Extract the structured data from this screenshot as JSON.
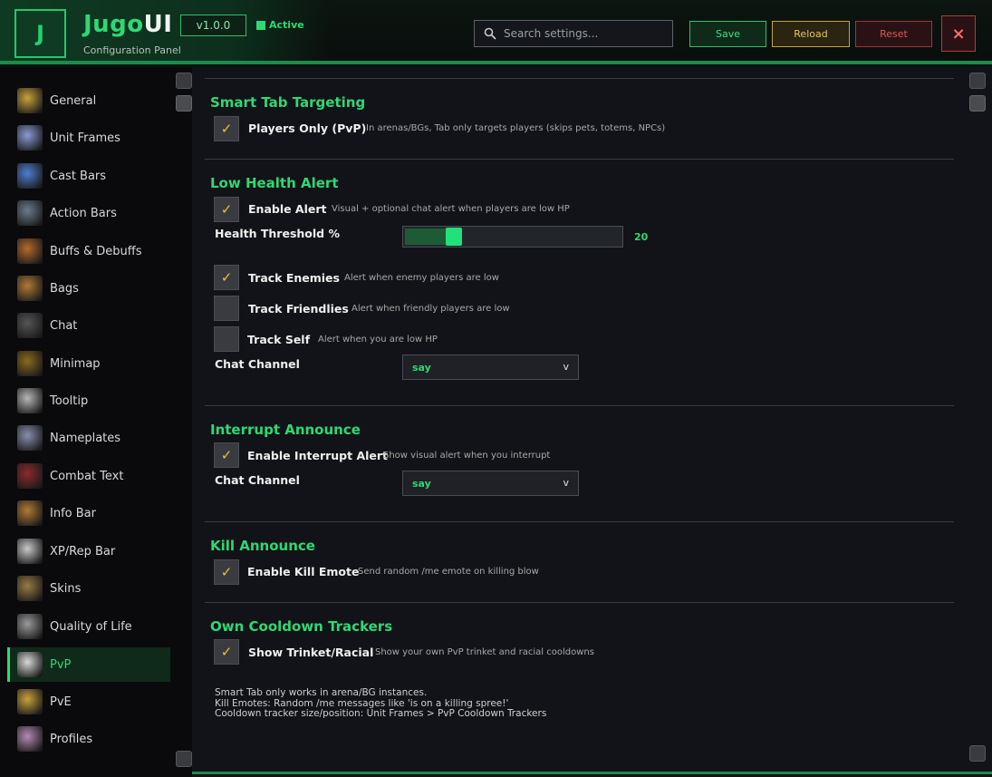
{
  "header": {
    "logo_letter": "J",
    "title_part1": "Jugo",
    "title_part2": "UI",
    "subtitle": "Configuration Panel",
    "version": "v1.0.0",
    "status": "Active",
    "search_placeholder": "Search settings...",
    "buttons": {
      "save": "Save",
      "reload": "Reload",
      "reset": "Reset",
      "close": "×"
    }
  },
  "sidebar": {
    "items": [
      {
        "label": "General",
        "icon": "gear-icon",
        "color": "#c9a23a"
      },
      {
        "label": "Unit Frames",
        "icon": "sparkle-icon",
        "color": "#8a9bd6"
      },
      {
        "label": "Cast Bars",
        "icon": "lightning-icon",
        "color": "#4d7fd1"
      },
      {
        "label": "Action Bars",
        "icon": "sword-icon",
        "color": "#6b7b8c"
      },
      {
        "label": "Buffs & Debuffs",
        "icon": "shield-icon",
        "color": "#b56a2b"
      },
      {
        "label": "Bags",
        "icon": "bag-icon",
        "color": "#b07a35"
      },
      {
        "label": "Chat",
        "icon": "chat-icon",
        "color": "#555555"
      },
      {
        "label": "Minimap",
        "icon": "map-icon",
        "color": "#8a6a1e"
      },
      {
        "label": "Tooltip",
        "icon": "scroll-icon",
        "color": "#b8b8b8"
      },
      {
        "label": "Nameplates",
        "icon": "arrow-icon",
        "color": "#8a8fb0"
      },
      {
        "label": "Combat Text",
        "icon": "text-icon",
        "color": "#8c2a2a"
      },
      {
        "label": "Info Bar",
        "icon": "quill-icon",
        "color": "#b07a35"
      },
      {
        "label": "XP/Rep Bar",
        "icon": "wings-icon",
        "color": "#c9c9c9"
      },
      {
        "label": "Skins",
        "icon": "book-icon",
        "color": "#9a7a45"
      },
      {
        "label": "Quality of Life",
        "icon": "cog-icon",
        "color": "#9a9a9a"
      },
      {
        "label": "PvP",
        "icon": "crossed-swords-icon",
        "color": "#d8d8d8"
      },
      {
        "label": "PvE",
        "icon": "helm-icon",
        "color": "#c9a23a"
      },
      {
        "label": "Profiles",
        "icon": "profile-icon",
        "color": "#b58ab5"
      }
    ],
    "active": "PvP"
  },
  "sections": {
    "smart_tab": {
      "title": "Smart Tab Targeting",
      "options": [
        {
          "label": "Players Only (PvP)",
          "desc": "In arenas/BGs, Tab only targets players (skips pets, totems, NPCs)",
          "checked": true
        }
      ]
    },
    "low_health": {
      "title": "Low Health Alert",
      "enable": {
        "label": "Enable Alert",
        "desc": "Visual + optional chat alert when players are low HP",
        "checked": true
      },
      "threshold_label": "Health Threshold %",
      "threshold_value": "20",
      "threshold_fraction": 0.2,
      "options": [
        {
          "label": "Track Enemies",
          "desc": "Alert when enemy players are low",
          "checked": true
        },
        {
          "label": "Track Friendlies",
          "desc": "Alert when friendly players are low",
          "checked": false
        },
        {
          "label": "Track Self",
          "desc": "Alert when you are low HP",
          "checked": false
        }
      ],
      "channel_label": "Chat Channel",
      "channel_value": "say"
    },
    "interrupt": {
      "title": "Interrupt Announce",
      "enable": {
        "label": "Enable Interrupt Alert",
        "desc": "Show visual alert when you interrupt",
        "checked": true
      },
      "channel_label": "Chat Channel",
      "channel_value": "say"
    },
    "kill": {
      "title": "Kill Announce",
      "enable": {
        "label": "Enable Kill Emote",
        "desc": "Send random /me emote on killing blow",
        "checked": true
      }
    },
    "cooldown": {
      "title": "Own Cooldown Trackers",
      "enable": {
        "label": "Show Trinket/Racial",
        "desc": "Show your own PvP trinket and racial cooldowns",
        "checked": true
      }
    }
  },
  "footnotes": [
    "Smart Tab only works in arena/BG instances.",
    "Kill Emotes: Random /me messages like 'is on a killing spree!'",
    "Cooldown tracker size/position: Unit Frames > PvP Cooldown Trackers"
  ],
  "colors": {
    "accent": "#2fd873",
    "check": "#e8c33a",
    "reload": "#e8c457",
    "reset": "#e05555"
  }
}
